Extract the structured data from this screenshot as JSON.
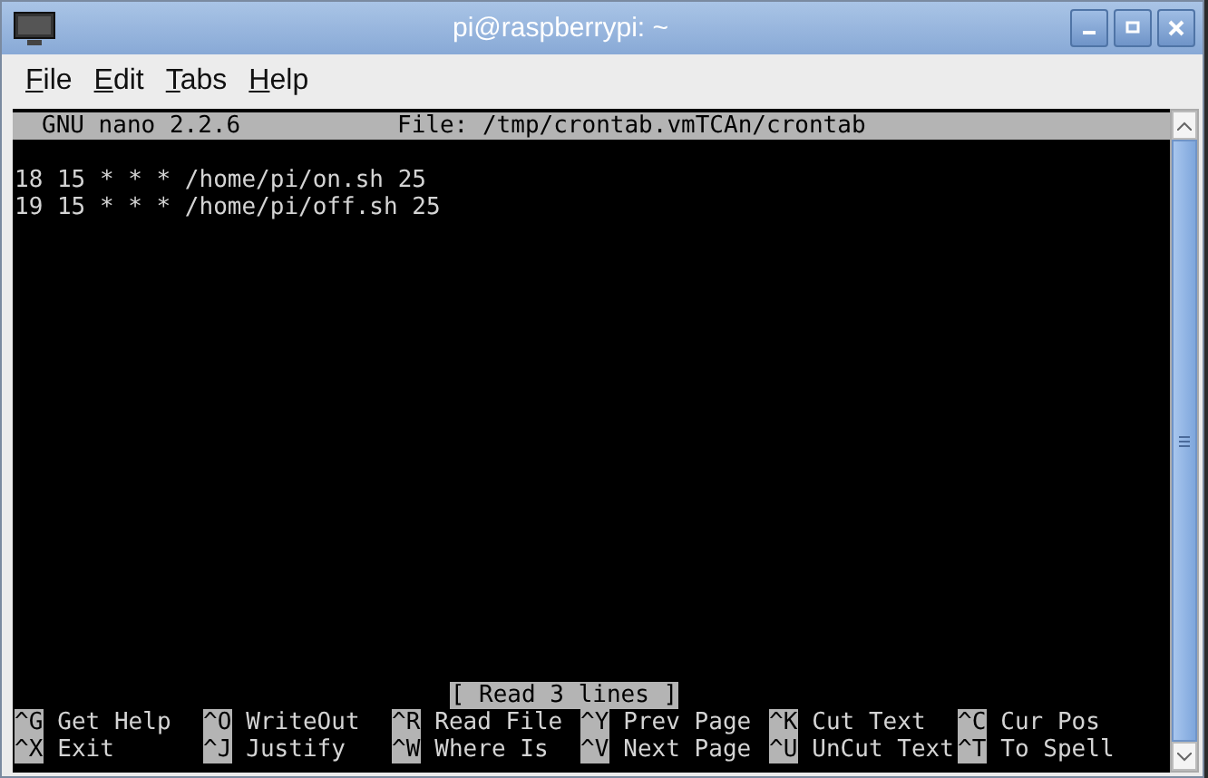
{
  "window": {
    "title": "pi@raspberrypi: ~"
  },
  "menu": [
    {
      "label": "File"
    },
    {
      "label": "Edit"
    },
    {
      "label": "Tabs"
    },
    {
      "label": "Help"
    }
  ],
  "nano": {
    "version": "GNU nano 2.2.6",
    "file": "File: /tmp/crontab.vmTCAn/crontab"
  },
  "lines": [
    "18 15 * * * /home/pi/on.sh 25",
    "19 15 * * * /home/pi/off.sh 25"
  ],
  "status": "[ Read 3 lines ]",
  "shortcuts": [
    [
      {
        "key": "^G",
        "label": "Get Help"
      },
      {
        "key": "^O",
        "label": "WriteOut"
      },
      {
        "key": "^R",
        "label": "Read File"
      },
      {
        "key": "^Y",
        "label": "Prev Page"
      },
      {
        "key": "^K",
        "label": "Cut Text"
      },
      {
        "key": "^C",
        "label": "Cur Pos"
      }
    ],
    [
      {
        "key": "^X",
        "label": "Exit"
      },
      {
        "key": "^J",
        "label": "Justify"
      },
      {
        "key": "^W",
        "label": "Where Is"
      },
      {
        "key": "^V",
        "label": "Next Page"
      },
      {
        "key": "^U",
        "label": "UnCut Text"
      },
      {
        "key": "^T",
        "label": "To Spell"
      }
    ]
  ]
}
